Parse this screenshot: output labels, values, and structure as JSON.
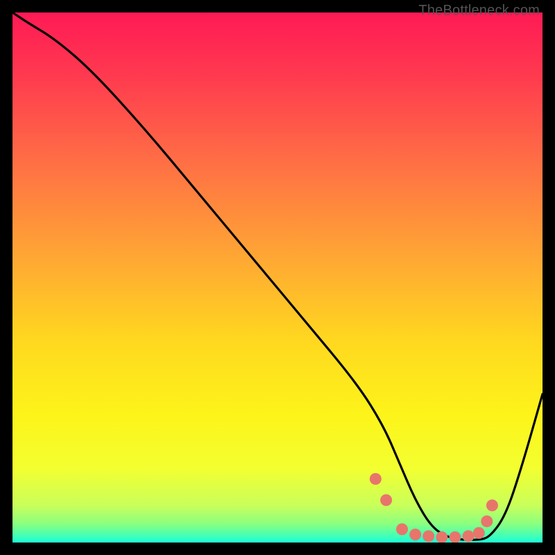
{
  "watermark": "TheBottleneck.com",
  "chart_data": {
    "type": "line",
    "title": "",
    "xlabel": "",
    "ylabel": "",
    "xlim": [
      0,
      100
    ],
    "ylim": [
      0,
      100
    ],
    "background": {
      "type": "vertical-gradient",
      "stops": [
        {
          "offset": 0.0,
          "color": "#ff1a55"
        },
        {
          "offset": 0.12,
          "color": "#ff3a4f"
        },
        {
          "offset": 0.28,
          "color": "#ff6e45"
        },
        {
          "offset": 0.45,
          "color": "#ffa335"
        },
        {
          "offset": 0.62,
          "color": "#ffd81f"
        },
        {
          "offset": 0.76,
          "color": "#fdf41a"
        },
        {
          "offset": 0.86,
          "color": "#f3ff30"
        },
        {
          "offset": 0.93,
          "color": "#c9ff5a"
        },
        {
          "offset": 0.965,
          "color": "#8aff80"
        },
        {
          "offset": 0.985,
          "color": "#4affb0"
        },
        {
          "offset": 1.0,
          "color": "#1affd8"
        }
      ]
    },
    "series": [
      {
        "name": "bottleneck-curve",
        "x": [
          0,
          3,
          8,
          15,
          25,
          35,
          45,
          55,
          65,
          70,
          73,
          76,
          79,
          82,
          85,
          88,
          90,
          93,
          96,
          100
        ],
        "y": [
          100,
          98,
          95,
          89,
          78,
          66,
          54,
          42,
          30,
          22,
          15,
          8,
          3,
          1,
          0.5,
          0.5,
          1,
          5,
          14,
          28
        ]
      }
    ],
    "markers": {
      "name": "highlight-dots",
      "color": "#e8756b",
      "x": [
        68.5,
        70.5,
        73.5,
        76,
        78.5,
        81,
        83.5,
        86,
        88,
        89.5,
        90.5
      ],
      "y": [
        12,
        8,
        2.5,
        1.5,
        1.2,
        1.0,
        1.0,
        1.2,
        1.8,
        4,
        7
      ]
    }
  }
}
